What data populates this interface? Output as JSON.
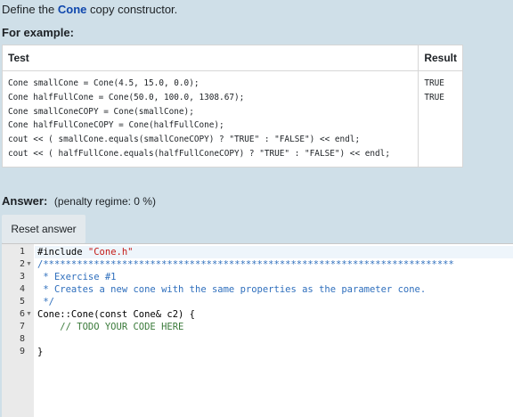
{
  "question": {
    "prompt_prefix": "Define the",
    "prompt_name": "Cone",
    "prompt_suffix": "copy constructor.",
    "for_example": "For example:"
  },
  "examples": {
    "headers": [
      "Test",
      "Result"
    ],
    "test_lines": [
      "Cone smallCone = Cone(4.5, 15.0, 0.0);",
      "Cone halfFullCone = Cone(50.0, 100.0, 1308.67);",
      "Cone smallConeCOPY = Cone(smallCone);",
      "Cone halfFullConeCOPY = Cone(halfFullCone);",
      "cout << ( smallCone.equals(smallConeCOPY) ? \"TRUE\" : \"FALSE\") << endl;",
      "cout << ( halfFullCone.equals(halfFullConeCOPY) ? \"TRUE\" : \"FALSE\") << endl;"
    ],
    "result_lines": [
      "TRUE",
      "TRUE"
    ]
  },
  "answer": {
    "label": "Answer:",
    "penalty": "(penalty regime: 0 %)",
    "reset_label": "Reset answer"
  },
  "editor": {
    "line_numbers": [
      "1",
      "2",
      "3",
      "4",
      "5",
      "6",
      "7",
      "8",
      "9"
    ],
    "lines": [
      "#include \"Cone.h\"",
      "/*************************************************************************",
      " * Exercise #1",
      " * Creates a new cone with the same properties as the parameter cone.",
      " */",
      "Cone::Cone(const Cone& c2) {",
      "    // TODO YOUR CODE HERE",
      "",
      "}"
    ]
  }
}
